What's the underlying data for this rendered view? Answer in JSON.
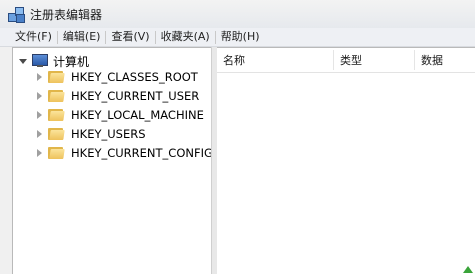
{
  "window": {
    "title": "注册表编辑器"
  },
  "menu": [
    {
      "label": "文件(F)"
    },
    {
      "label": "编辑(E)"
    },
    {
      "label": "查看(V)"
    },
    {
      "label": "收藏夹(A)"
    },
    {
      "label": "帮助(H)"
    }
  ],
  "tree": {
    "root_label": "计算机",
    "items": [
      {
        "label": "HKEY_CLASSES_ROOT"
      },
      {
        "label": "HKEY_CURRENT_USER"
      },
      {
        "label": "HKEY_LOCAL_MACHINE"
      },
      {
        "label": "HKEY_USERS"
      },
      {
        "label": "HKEY_CURRENT_CONFIG"
      }
    ]
  },
  "list": {
    "columns": [
      {
        "label": "名称"
      },
      {
        "label": "类型"
      },
      {
        "label": "数据"
      }
    ]
  },
  "icons": {
    "app": "registry-editor-icon",
    "root": "computer-icon",
    "hive": "folder-icon"
  }
}
